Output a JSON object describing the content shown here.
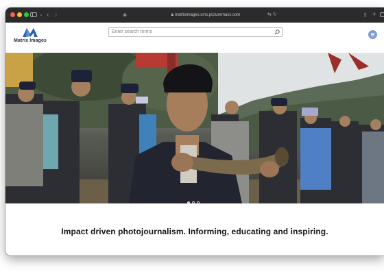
{
  "browser": {
    "url": "matriximages.cms.picturemaxx.com",
    "icons": [
      "close",
      "minimize",
      "maximize",
      "sidebar-icon",
      "chevron-down-icon",
      "back-icon",
      "forward-icon",
      "shield-icon",
      "lock-icon",
      "translate-icon",
      "reload-icon",
      "share-icon",
      "plus-icon",
      "tabs-icon"
    ]
  },
  "site": {
    "logo_text": "Matrix Images",
    "search_placeholder": "Enter search terms",
    "menu_icon": "hamburger-icon",
    "brand_color": "#2b5fb3",
    "accent_color": "#7d9fd4"
  },
  "hero": {
    "slides_total": 3,
    "active_slide": 1
  },
  "tagline": "Impact driven photojournalism. Informing, educating and inspiring."
}
